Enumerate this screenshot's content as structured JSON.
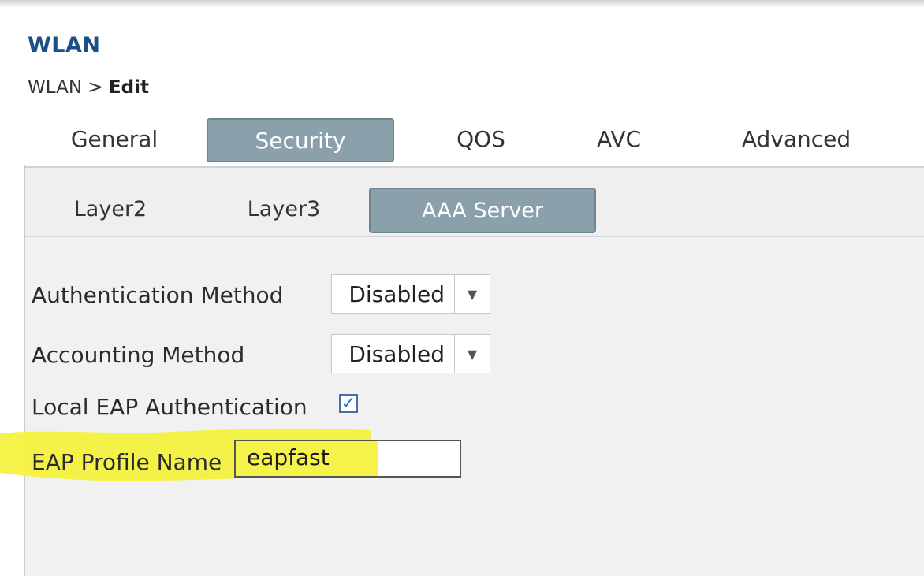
{
  "header": {
    "title": "WLAN",
    "breadcrumb_prefix": "WLAN > ",
    "breadcrumb_current": "Edit"
  },
  "tabs": [
    {
      "label": "General",
      "active": false
    },
    {
      "label": "Security",
      "active": true
    },
    {
      "label": "QOS",
      "active": false
    },
    {
      "label": "AVC",
      "active": false
    },
    {
      "label": "Advanced",
      "active": false
    }
  ],
  "subtabs": [
    {
      "label": "Layer2",
      "active": false
    },
    {
      "label": "Layer3",
      "active": false
    },
    {
      "label": "AAA Server",
      "active": true
    }
  ],
  "form": {
    "authentication_method": {
      "label": "Authentication Method",
      "value": "Disabled"
    },
    "accounting_method": {
      "label": "Accounting Method",
      "value": "Disabled"
    },
    "local_eap": {
      "label": "Local EAP Authentication",
      "checked": true
    },
    "eap_profile": {
      "label": "EAP Profile Name",
      "value": "eapfast"
    }
  },
  "colors": {
    "title": "#1b4f87",
    "active_tab": "#8aa0aa",
    "highlight": "#f4f23a"
  },
  "icons": {
    "dropdown": "chevron-down-icon",
    "check": "checkmark-icon"
  }
}
